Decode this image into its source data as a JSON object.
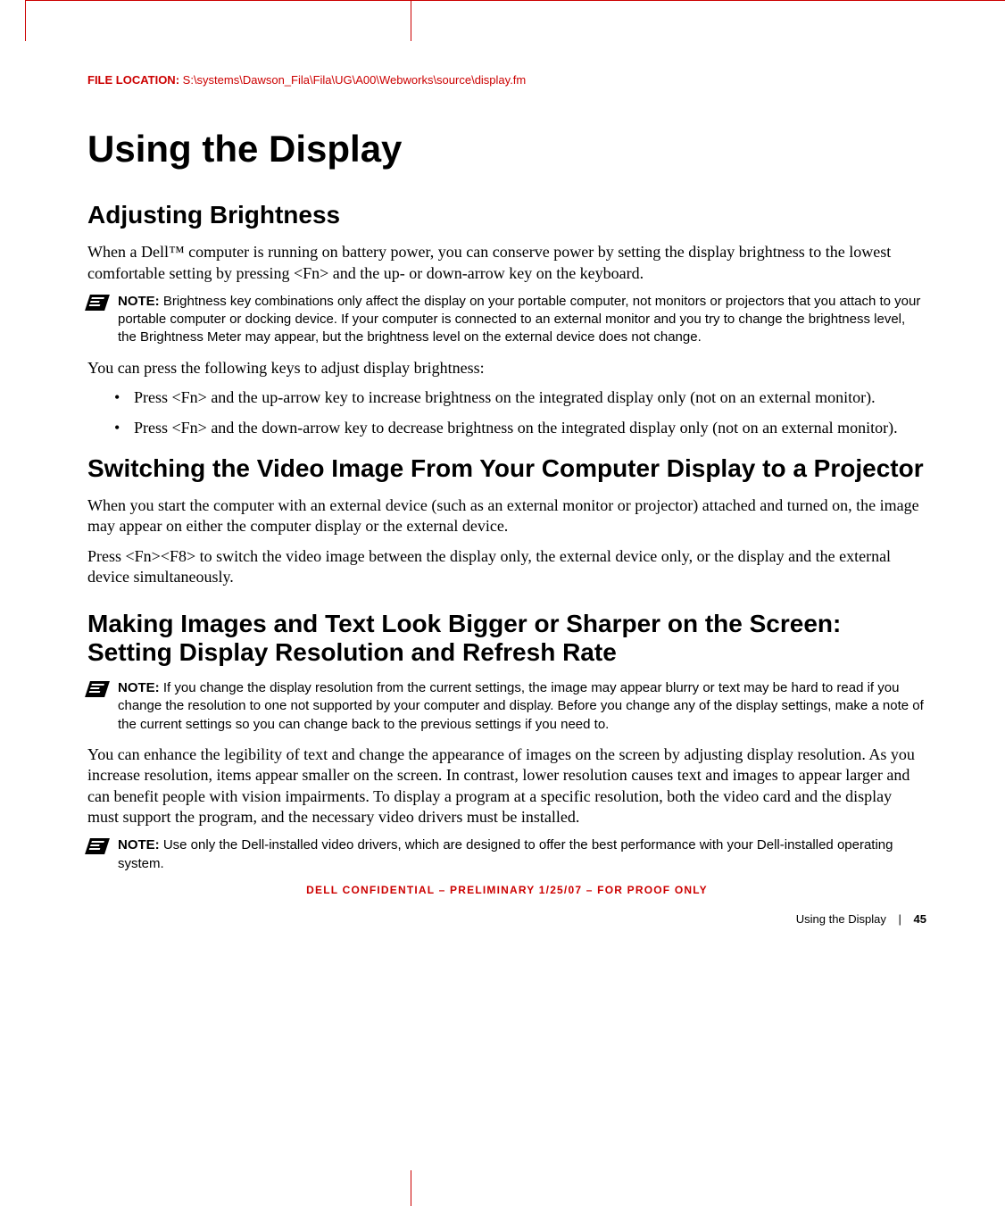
{
  "file_location": {
    "label": "FILE LOCATION:",
    "path": "S:\\systems\\Dawson_Fila\\Fila\\UG\\A00\\Webworks\\source\\display.fm"
  },
  "h1": "Using the Display",
  "sections": [
    {
      "h2": "Adjusting Brightness",
      "intro": "When a Dell™ computer is running on battery power, you can conserve power by setting the display brightness to the lowest comfortable setting by pressing <Fn> and the up- or down-arrow key on the keyboard.",
      "note1": {
        "label": "NOTE:",
        "text": "Brightness key combinations only affect the display on your portable computer, not monitors or projectors that you attach to your portable computer or docking device. If your computer is connected to an external monitor and you try to change the brightness level, the Brightness Meter may appear, but the brightness level on the external device does not change."
      },
      "lead": "You can press the following keys to adjust display brightness:",
      "bullets": [
        "Press <Fn> and the up-arrow key to increase brightness on the integrated display only (not on an external monitor).",
        "Press <Fn> and the down-arrow key to decrease brightness on the integrated display only (not on an external monitor)."
      ]
    },
    {
      "h2": "Switching the Video Image From Your Computer Display to a Projector",
      "paras": [
        "When you start the computer with an external device (such as an external monitor or projector) attached and turned on, the image may appear on either the computer display or the external device.",
        "Press <Fn><F8> to switch the video image between the display only, the external device only, or the display and the external device simultaneously."
      ]
    },
    {
      "h2": "Making Images and Text Look Bigger or Sharper on the Screen: Setting Display Resolution and Refresh Rate",
      "note1": {
        "label": "NOTE:",
        "text": "If you change the display resolution from the current settings, the image may appear blurry or text may be hard to read if you change the resolution to one not supported by your computer and display. Before you change any of the display settings, make a note of the current settings so you can change back to the previous settings if you need to."
      },
      "para": "You can enhance the legibility of text and change the appearance of images on the screen by adjusting display resolution. As you increase resolution, items appear smaller on the screen. In contrast, lower resolution causes text and images to appear larger and can benefit people with vision impairments. To display a program at a specific resolution, both the video card and the display must support the program, and the necessary video drivers must be installed.",
      "note2": {
        "label": "NOTE:",
        "text": "Use only the Dell-installed video drivers, which are designed to offer the best performance with your Dell-installed operating system."
      }
    }
  ],
  "confidential": "DELL CONFIDENTIAL – PRELIMINARY 1/25/07 – FOR PROOF ONLY",
  "footer": {
    "section": "Using the Display",
    "sep": "|",
    "page": "45"
  }
}
